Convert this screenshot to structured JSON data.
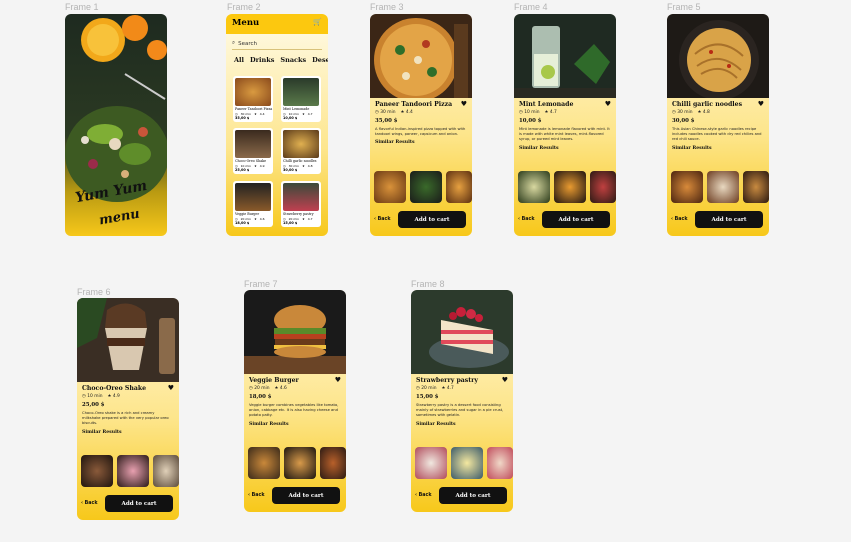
{
  "frames": {
    "f1": "Frame 1",
    "f2": "Frame 2",
    "f3": "Frame 3",
    "f4": "Frame 4",
    "f5": "Frame 5",
    "f6": "Frame 6",
    "f7": "Frame 7",
    "f8": "Frame 8"
  },
  "splash": {
    "line1": "Yum Yum",
    "line2": "menu"
  },
  "menu": {
    "title": "Menu",
    "search_placeholder": "Search",
    "tabs": [
      "All",
      "Drinks",
      "Snacks",
      "Deserts"
    ],
    "cards": [
      {
        "name": "Paneer Tandoori Pizza",
        "time": "30 min",
        "rating": "4.4",
        "price": "35,00 $"
      },
      {
        "name": "Mint Lemonade",
        "time": "10 min",
        "rating": "4.7",
        "price": "10,00 $"
      },
      {
        "name": "Choco-Oreo Shake",
        "time": "10 min",
        "rating": "4.9",
        "price": "25,00 $"
      },
      {
        "name": "Chilli garlic noodles",
        "time": "30 min",
        "rating": "4.8",
        "price": "30,00 $"
      },
      {
        "name": "Veggie Burger",
        "time": "20 min",
        "rating": "4.6",
        "price": "18,00 $"
      },
      {
        "name": "Strawberry pastry",
        "time": "20 min",
        "rating": "4.7",
        "price": "15,00 $"
      }
    ]
  },
  "details": {
    "pizza": {
      "name": "Paneer Tandoori Pizza",
      "time": "30 min",
      "rating": "4.4",
      "price": "35,00 $",
      "desc": "A flavorful Indian-inspired pizza topped with with tandoori wings, paneer, capsicum and onion."
    },
    "lemonade": {
      "name": "Mint Lemonade",
      "time": "10 min",
      "rating": "4.7",
      "price": "10,00 $",
      "desc": "Mint lemonade is lemonade flavored with mint. It is made with white mint leaves, mint-flavored syrup, or pureed mint leaves."
    },
    "noodles": {
      "name": "Chilli garlic noodles",
      "time": "30 min",
      "rating": "4.8",
      "price": "30,00 $",
      "desc": "This Asian Chinese-style garlic noodles recipe includes noodles cooked with dry red chilies and red chili sauce."
    },
    "shake": {
      "name": "Choco-Oreo Shake",
      "time": "10 min",
      "rating": "4.9",
      "price": "25,00 $",
      "desc": "Choco-Oreo shake is a rich and creamy milkshake prepared with the very popular oreo biscuits."
    },
    "burger": {
      "name": "Veggie Burger",
      "time": "20 min",
      "rating": "4.6",
      "price": "18,00 $",
      "desc": "Veggie burger combines vegetables like tomato, onion, cabbage etc. It is also having cheese and potato patty."
    },
    "pastry": {
      "name": "Strawberry pastry",
      "time": "20 min",
      "rating": "4.7",
      "price": "15,00 $",
      "desc": "Strawberry pastry is a dessert food consisting mainly of strawberries and sugar in a pie crust, sometimes with gelatin."
    }
  },
  "common": {
    "similar": "Similar Results",
    "back": "Back",
    "add_to_cart": "Add to cart"
  },
  "icons": {
    "time": "clock-icon",
    "rating": "star-icon",
    "favorite": "heart-icon",
    "cart": "cart-icon",
    "search": "search-icon"
  },
  "colors": {
    "accent": "#fcc80f",
    "button": "#111111",
    "background": "#f4f4f4"
  }
}
